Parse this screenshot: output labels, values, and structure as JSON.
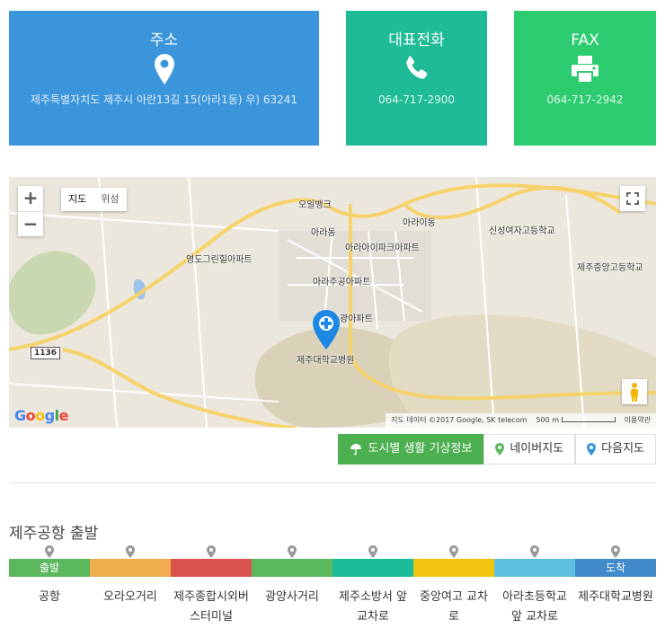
{
  "info": {
    "address": {
      "title": "주소",
      "icon": "map-marker-icon",
      "text": "제주특별자치도 제주시 아란13길 15(아라1동) 우) 63241"
    },
    "phone": {
      "title": "대표전화",
      "icon": "phone-icon",
      "text": "064-717-2900"
    },
    "fax": {
      "title": "FAX",
      "icon": "printer-icon",
      "text": "064-717-2942"
    }
  },
  "map": {
    "zoom_in": "+",
    "zoom_out": "−",
    "type_map": "지도",
    "type_satellite": "위성",
    "road_shield": "1136",
    "labels": {
      "ora_bank": "오일뱅크",
      "arai_dong": "아라이동",
      "ara_dong": "아라동",
      "arai_park": "아라아이파크아파트",
      "sinseong": "신성여자고등학교",
      "jeju_central": "제주중앙고등학교",
      "yeongdo": "영도그린힐아파트",
      "arajugong": "아라주공아파트",
      "gwangyang": "광아파트",
      "hospital": "제주대학교병원"
    },
    "attribution": "지도 데이터 ©2017 Google, SK telecom",
    "scale": "500 m",
    "terms": "이용약관",
    "brand": [
      "G",
      "o",
      "o",
      "g",
      "l",
      "e"
    ]
  },
  "buttons": {
    "weather": "도시별 생활 기상정보",
    "naver": "네이버지도",
    "daum": "다음지도"
  },
  "route": {
    "title": "제주공항 출발",
    "start_label": "출발",
    "end_label": "도착",
    "colors": [
      "#5cb85c",
      "#f0ad4e",
      "#d9534f",
      "#5cb85c",
      "#1abc9c",
      "#f1c40f",
      "#5bc0de",
      "#428bca"
    ],
    "stops": [
      "공항",
      "오라오거리",
      "제주종합시외버스터미널",
      "광양사거리",
      "제주소방서 앞 교차로",
      "중앙여고 교차로",
      "아라초등학교 앞 교차로",
      "제주대학교병원"
    ]
  }
}
